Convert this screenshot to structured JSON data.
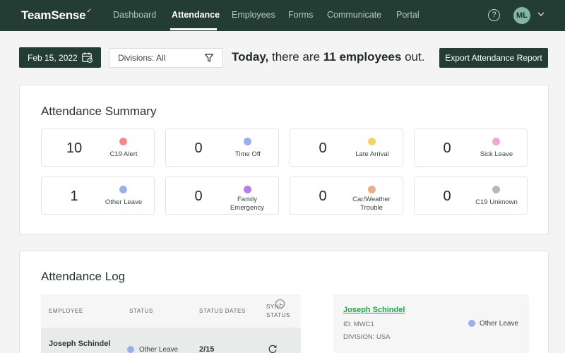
{
  "app": {
    "logo": "TeamSense",
    "logo_mark": "✓"
  },
  "nav": {
    "items": [
      {
        "label": "Dashboard",
        "active": false
      },
      {
        "label": "Attendance",
        "active": true
      },
      {
        "label": "Employees",
        "active": false
      },
      {
        "label": "Forms",
        "active": false
      },
      {
        "label": "Communicate",
        "active": false
      },
      {
        "label": "Portal",
        "active": false
      }
    ],
    "help_icon": "question-circle-icon",
    "help_glyph": "?",
    "avatar_initials": "ML",
    "menu_icon": "chevron-down-icon"
  },
  "toolbar": {
    "date": "Feb 15, 2022",
    "date_icon": "calendar-icon",
    "division": "Divisions: All",
    "filter_icon": "filter-icon",
    "today_prefix": "Today,",
    "today_mid": " there are ",
    "today_count": "11 employees",
    "today_suffix": " out.",
    "export_label": "Export Attendance Report"
  },
  "summary": {
    "title": "Attendance Summary",
    "cards": [
      {
        "count": "10",
        "label": "C19 Alert",
        "color": "#ef8c8c"
      },
      {
        "count": "0",
        "label": "Time Off",
        "color": "#98b1ea"
      },
      {
        "count": "0",
        "label": "Late Arrival",
        "color": "#f4d35e"
      },
      {
        "count": "0",
        "label": "Sick Leave",
        "color": "#f3a6cf"
      },
      {
        "count": "1",
        "label": "Other Leave",
        "color": "#98b1ea"
      },
      {
        "count": "0",
        "label": "Family Emergency",
        "color": "#b57ee5"
      },
      {
        "count": "0",
        "label": "Car/Weather Trouble",
        "color": "#e9ae88"
      },
      {
        "count": "0",
        "label": "C19 Unknown",
        "color": "#b8b8b8"
      }
    ]
  },
  "log": {
    "title": "Attendance Log",
    "headers": {
      "employee": "EMPLOYEE",
      "status": "STATUS",
      "status_dates": "STATUS DATES",
      "sync_status_1": "SYNC",
      "sync_status_2": "STATUS"
    },
    "info_icon": "info-icon",
    "info_glyph": "i",
    "rows": [
      {
        "employee": "Joseph Schindel",
        "status": "Other Leave",
        "status_color": "#98b1ea",
        "dates": "2/15",
        "sync_icon": "refresh-icon"
      }
    ],
    "detail": {
      "name": "Joseph Schindel",
      "id": "ID: MWC1",
      "division": "DIVISION: USA",
      "status": "Other Leave",
      "status_color": "#98b1ea"
    }
  }
}
